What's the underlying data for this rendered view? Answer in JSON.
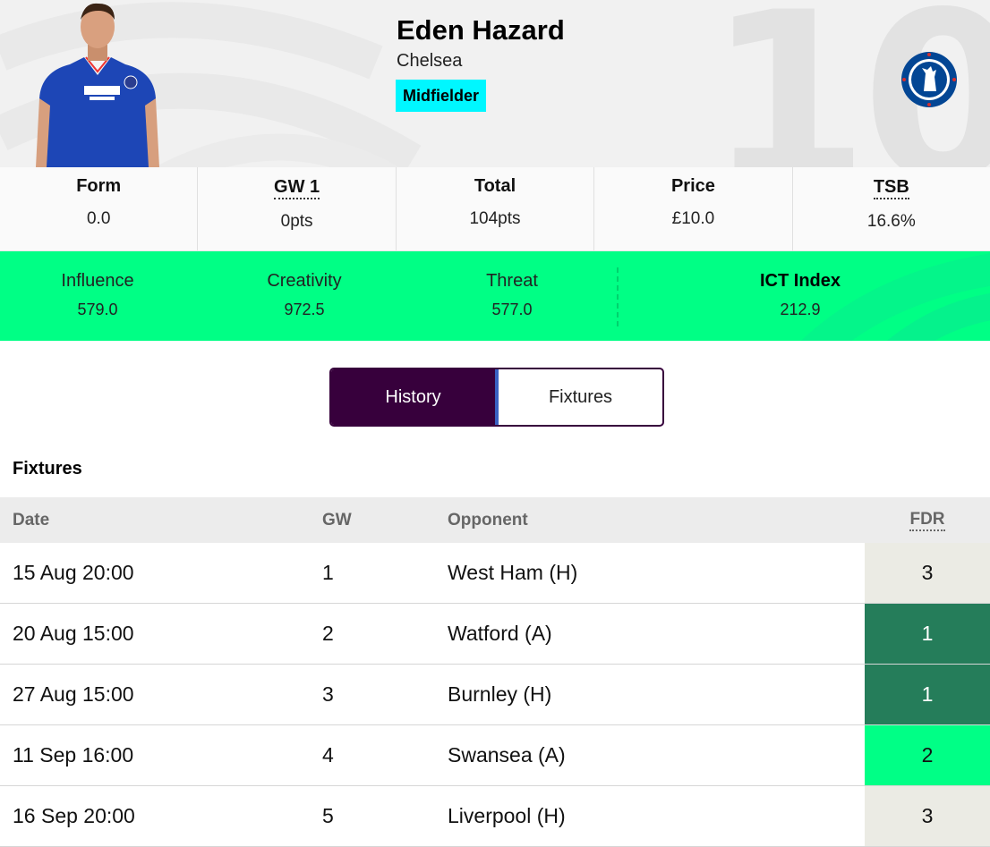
{
  "player": {
    "name": "Eden Hazard",
    "team": "Chelsea",
    "position": "Midfielder",
    "shirt_number": "10"
  },
  "stats": [
    {
      "label": "Form",
      "value": "0.0",
      "dotted": false
    },
    {
      "label": "GW 1",
      "value": "0pts",
      "dotted": true
    },
    {
      "label": "Total",
      "value": "104pts",
      "dotted": false
    },
    {
      "label": "Price",
      "value": "£10.0",
      "dotted": false
    },
    {
      "label": "TSB",
      "value": "16.6%",
      "dotted": true
    }
  ],
  "ict": [
    {
      "label": "Influence",
      "value": "579.0"
    },
    {
      "label": "Creativity",
      "value": "972.5"
    },
    {
      "label": "Threat",
      "value": "577.0"
    },
    {
      "label": "ICT Index",
      "value": "212.9"
    }
  ],
  "tabs": {
    "history": "History",
    "fixtures": "Fixtures"
  },
  "fixtures": {
    "title": "Fixtures",
    "headers": {
      "date": "Date",
      "gw": "GW",
      "opponent": "Opponent",
      "fdr": "FDR"
    },
    "rows": [
      {
        "date": "15 Aug 20:00",
        "gw": "1",
        "opponent": "West Ham (H)",
        "fdr": "3"
      },
      {
        "date": "20 Aug 15:00",
        "gw": "2",
        "opponent": "Watford (A)",
        "fdr": "1"
      },
      {
        "date": "27 Aug 15:00",
        "gw": "3",
        "opponent": "Burnley (H)",
        "fdr": "1"
      },
      {
        "date": "11 Sep 16:00",
        "gw": "4",
        "opponent": "Swansea (A)",
        "fdr": "2"
      },
      {
        "date": "16 Sep 20:00",
        "gw": "5",
        "opponent": "Liverpool (H)",
        "fdr": "3"
      }
    ]
  },
  "colors": {
    "position_badge": "#00f7ff",
    "ict_bar": "#00ff85",
    "tab_active": "#37003c",
    "fdr_1": "#257d5a",
    "fdr_2": "#00ff86",
    "fdr_3": "#ebebe4"
  }
}
